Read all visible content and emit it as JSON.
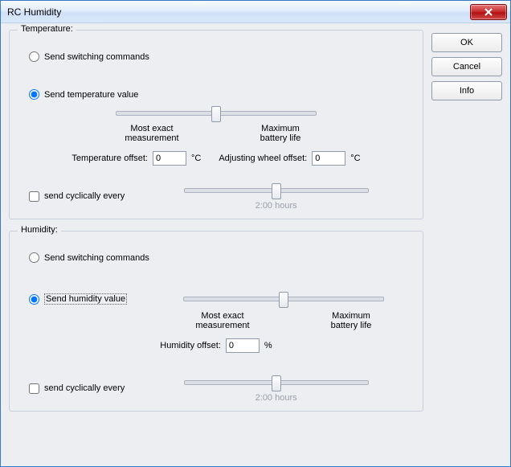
{
  "window": {
    "title": "RC Humidity"
  },
  "buttons": {
    "ok": "OK",
    "cancel": "Cancel",
    "info": "Info"
  },
  "temperature": {
    "legend": "Temperature:",
    "radio_switching": "Send switching commands",
    "radio_value": "Send temperature value",
    "radio_selected": "value",
    "slider": {
      "left_label": "Most exact\nmeasurement",
      "right_label": "Maximum\nbattery life",
      "percent": 50
    },
    "temp_offset_label": "Temperature offset:",
    "temp_offset_value": "0",
    "temp_offset_unit": "°C",
    "adj_offset_label": "Adjusting wheel offset:",
    "adj_offset_value": "0",
    "adj_offset_unit": "°C",
    "cyclic_label": "send cyclically every",
    "cyclic_checked": false,
    "cyclic_slider_percent": 50,
    "cyclic_value_label": "2:00 hours"
  },
  "humidity": {
    "legend": "Humidity:",
    "radio_switching": "Send switching commands",
    "radio_value": "Send humidity value",
    "radio_selected": "value",
    "slider": {
      "left_label": "Most exact\nmeasurement",
      "right_label": "Maximum\nbattery life",
      "percent": 50
    },
    "hum_offset_label": "Humidity offset:",
    "hum_offset_value": "0",
    "hum_offset_unit": "%",
    "cyclic_label": "send cyclically every",
    "cyclic_checked": false,
    "cyclic_slider_percent": 50,
    "cyclic_value_label": "2:00 hours"
  }
}
